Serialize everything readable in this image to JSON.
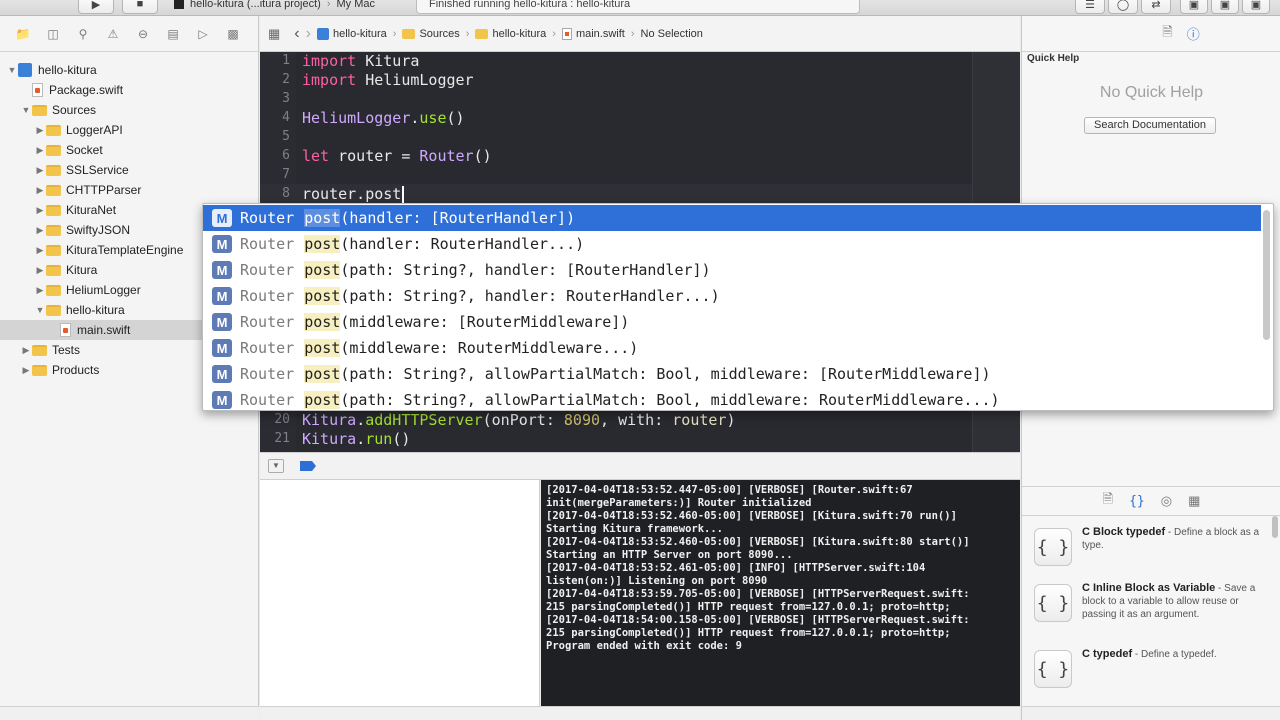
{
  "toolbar": {
    "scheme_label": "hello-kitura (...itura project)",
    "destination_label": "My Mac",
    "activity_text": "Finished running hello-kitura : hello-kitura"
  },
  "navigator": {
    "items": [
      {
        "label": "hello-kitura",
        "kind": "project",
        "indent": 0,
        "open": true
      },
      {
        "label": "Package.swift",
        "kind": "file",
        "indent": 1
      },
      {
        "label": "Sources",
        "kind": "folder",
        "indent": 1,
        "open": true
      },
      {
        "label": "LoggerAPI",
        "kind": "folder",
        "indent": 2,
        "open": false
      },
      {
        "label": "Socket",
        "kind": "folder",
        "indent": 2,
        "open": false
      },
      {
        "label": "SSLService",
        "kind": "folder",
        "indent": 2,
        "open": false
      },
      {
        "label": "CHTTPParser",
        "kind": "folder",
        "indent": 2,
        "open": false
      },
      {
        "label": "KituraNet",
        "kind": "folder",
        "indent": 2,
        "open": false
      },
      {
        "label": "SwiftyJSON",
        "kind": "folder",
        "indent": 2,
        "open": false
      },
      {
        "label": "KituraTemplateEngine",
        "kind": "folder",
        "indent": 2,
        "open": false
      },
      {
        "label": "Kitura",
        "kind": "folder",
        "indent": 2,
        "open": false
      },
      {
        "label": "HeliumLogger",
        "kind": "folder",
        "indent": 2,
        "open": false
      },
      {
        "label": "hello-kitura",
        "kind": "folder",
        "indent": 2,
        "open": true
      },
      {
        "label": "main.swift",
        "kind": "swift",
        "indent": 3,
        "selected": true
      },
      {
        "label": "Tests",
        "kind": "folder",
        "indent": 1,
        "open": false
      },
      {
        "label": "Products",
        "kind": "folder",
        "indent": 1,
        "open": false
      }
    ]
  },
  "jumpbar": {
    "crumbs": [
      "hello-kitura",
      "Sources",
      "hello-kitura",
      "main.swift",
      "No Selection"
    ]
  },
  "editor": {
    "lines": [
      {
        "n": "1",
        "html": "<span class='kw'>import</span> Kitura"
      },
      {
        "n": "2",
        "html": "<span class='kw'>import</span> HeliumLogger"
      },
      {
        "n": "3",
        "html": ""
      },
      {
        "n": "4",
        "html": "<span class='ty'>HeliumLogger</span>.<span class='fn'>use</span>()"
      },
      {
        "n": "5",
        "html": ""
      },
      {
        "n": "6",
        "html": "<span class='kw'>let</span> router = <span class='ty'>Router</span>()"
      },
      {
        "n": "7",
        "html": ""
      },
      {
        "n": "8",
        "html": "router.post<span class='caret'></span>",
        "current": true
      },
      {
        "n": "20",
        "html": "<span class='ty'>Kitura</span>.<span class='fn'>addHTTPServer</span>(onPort: <span class='num'>8090</span>, with: <span class='var'>router</span>)"
      },
      {
        "n": "21",
        "html": "<span class='ty'>Kitura</span>.<span class='fn'>run</span>()"
      }
    ]
  },
  "completion": {
    "badge": "M",
    "type": "Router",
    "match": "post",
    "items": [
      "(handler: [RouterHandler])",
      "(handler: RouterHandler...)",
      "(path: String?, handler: [RouterHandler])",
      "(path: String?, handler: RouterHandler...)",
      "(middleware: [RouterMiddleware])",
      "(middleware: RouterMiddleware...)",
      "(path: String?, allowPartialMatch: Bool, middleware: [RouterMiddleware])",
      "(path: String?, allowPartialMatch: Bool, middleware: RouterMiddleware...)"
    ]
  },
  "console": {
    "text": "[2017-04-04T18:53:52.447-05:00] [VERBOSE] [Router.swift:67\ninit(mergeParameters:)] Router initialized\n[2017-04-04T18:53:52.460-05:00] [VERBOSE] [Kitura.swift:70 run()]\nStarting Kitura framework...\n[2017-04-04T18:53:52.460-05:00] [VERBOSE] [Kitura.swift:80 start()]\nStarting an HTTP Server on port 8090...\n[2017-04-04T18:53:52.461-05:00] [INFO] [HTTPServer.swift:104\nlisten(on:)] Listening on port 8090\n[2017-04-04T18:53:59.705-05:00] [VERBOSE] [HTTPServerRequest.swift:\n215 parsingCompleted()] HTTP request from=127.0.0.1; proto=http;\n[2017-04-04T18:54:00.158-05:00] [VERBOSE] [HTTPServerRequest.swift:\n215 parsingCompleted()] HTTP request from=127.0.0.1; proto=http;\nProgram ended with exit code: 9"
  },
  "inspector": {
    "quick_help_title": "Quick Help",
    "no_quick_help": "No Quick Help",
    "search_button": "Search Documentation",
    "library": [
      {
        "icon": "{ }",
        "title": "C Block typedef",
        "desc": " - Define a block as a type."
      },
      {
        "icon": "{ }",
        "title": "C Inline Block as Variable",
        "desc": " - Save a block to a variable to allow reuse or passing it as an argument."
      },
      {
        "icon": "{ }",
        "title": "C typedef",
        "desc": " - Define a typedef."
      }
    ]
  },
  "colors": {
    "editor_bg": "#292a30",
    "selection_blue": "#2e6fd8",
    "keyword": "#fc5fa3"
  }
}
